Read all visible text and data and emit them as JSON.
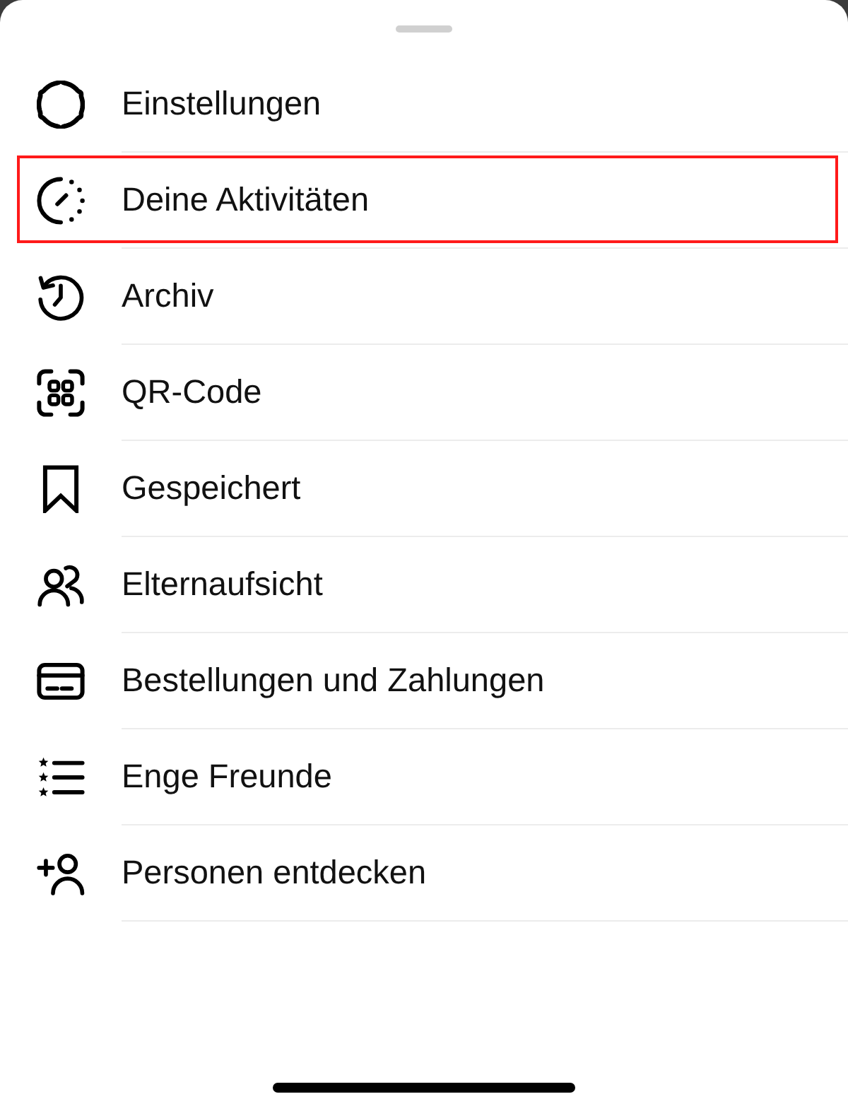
{
  "sheet": {
    "items": [
      {
        "kind": "settings",
        "label": "Einstellungen",
        "highlighted": false
      },
      {
        "kind": "activity",
        "label": "Deine Aktivitäten",
        "highlighted": true
      },
      {
        "kind": "archive",
        "label": "Archiv",
        "highlighted": false
      },
      {
        "kind": "qr",
        "label": "QR-Code",
        "highlighted": false
      },
      {
        "kind": "saved",
        "label": "Gespeichert",
        "highlighted": false
      },
      {
        "kind": "supervision",
        "label": "Elternaufsicht",
        "highlighted": false
      },
      {
        "kind": "payments",
        "label": "Bestellungen und Zahlungen",
        "highlighted": false
      },
      {
        "kind": "close_friends",
        "label": "Enge Freunde",
        "highlighted": false
      },
      {
        "kind": "discover",
        "label": "Personen entdecken",
        "highlighted": false
      }
    ]
  }
}
